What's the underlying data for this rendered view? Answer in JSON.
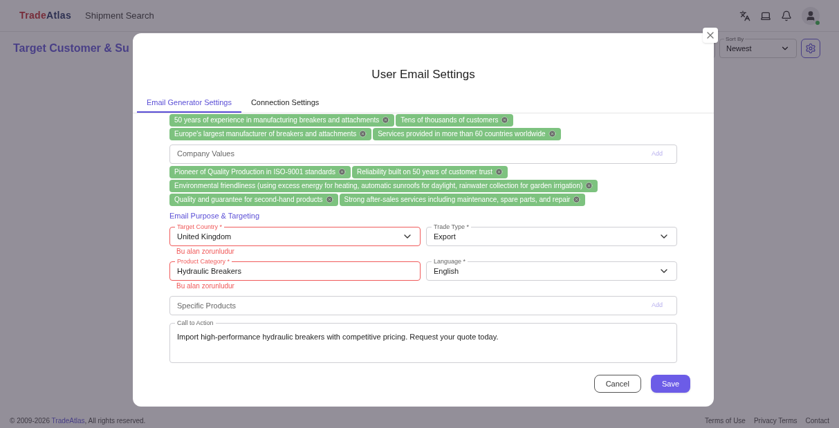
{
  "header": {
    "logo": {
      "first": "Trade",
      "second": "Atlas"
    },
    "nav": "Shipment Search"
  },
  "page": {
    "title": "Target Customer & Su",
    "sort": {
      "label": "Sort By",
      "value": "Newest"
    }
  },
  "modal": {
    "title": "User Email Settings",
    "tabs": [
      {
        "label": "Email Generator Settings",
        "selected": true
      },
      {
        "label": "Connection Settings",
        "selected": false
      }
    ],
    "top_tags": [
      "50 years of experience in manufacturing breakers and attachments",
      "Tens of thousands of customers",
      "Europe's largest manufacturer of breakers and attachments",
      "Services provided in more than 60 countries worldwide"
    ],
    "company_values": {
      "placeholder": "Company Values",
      "add": "Add",
      "tags": [
        "Pioneer of Quality Production in ISO-9001 standards",
        "Reliability built on 50 years of customer trust",
        "Environmental friendliness (using excess energy for heating, automatic sunroofs for daylight, rainwater collection for garden irrigation)",
        "Quality and guarantee for second-hand products",
        "Strong after-sales services including maintenance, spare parts, and repair"
      ]
    },
    "section_title": "Email Purpose & Targeting",
    "field_rows": [
      [
        {
          "kind": "select",
          "label": "Target Country *",
          "value": "United Kingdom",
          "error": "Bu alan zorunludur"
        },
        {
          "kind": "select",
          "label": "Trade Type *",
          "value": "Export"
        }
      ],
      [
        {
          "kind": "text",
          "label": "Product Category *",
          "value": "Hydraulic Breakers",
          "error": "Bu alan zorunludur"
        },
        {
          "kind": "select",
          "label": "Language *",
          "value": "English"
        }
      ]
    ],
    "specific_products": {
      "placeholder": "Specific Products",
      "add": "Add"
    },
    "call_to_action": {
      "label": "Call to Action",
      "value": "Import high-performance hydraulic breakers with competitive pricing. Request your quote today."
    },
    "buttons": {
      "cancel": "Cancel",
      "save": "Save"
    }
  },
  "footer": {
    "copyright_prefix": "© 2009-2026 ",
    "brand": "TradeAtlas",
    "copyright_suffix": ", All rights reserved.",
    "links": [
      "Terms of Use",
      "Privacy Terms",
      "Contact"
    ]
  }
}
